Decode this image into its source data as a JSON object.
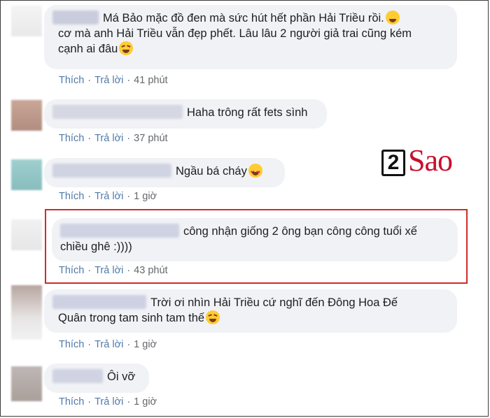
{
  "comments": [
    {
      "text": "Má Bảo mặc đồ đen mà sức hút hết phần Hải Triều rồi.",
      "text2": "cơ mà anh Hải Triều vẫn đẹp phết. Lâu lâu 2 người giả trai cũng kém",
      "text3": "cạnh ai đâu",
      "like": "Thích",
      "reply": "Trả lời",
      "time": "41 phút"
    },
    {
      "text": "Haha trông rất fets sình",
      "like": "Thích",
      "reply": "Trả lời",
      "time": "37 phút"
    },
    {
      "text": "Ngầu bá cháy",
      "like": "Thích",
      "reply": "Trả lời",
      "time": "1 giờ"
    },
    {
      "text": "công nhận giống 2 ông bạn công công tuổi xế",
      "text2": "chiều ghê :))))",
      "like": "Thích",
      "reply": "Trả lời",
      "time": "43 phút"
    },
    {
      "text": "Trời ơi nhìn Hải Triều cứ nghĩ đến Đông Hoa Đế",
      "text2": "Quân trong tam sinh tam thế",
      "like": "Thích",
      "reply": "Trả lời",
      "time": "1 giờ"
    },
    {
      "text": "Ôi vỡ",
      "like": "Thích",
      "reply": "Trả lời",
      "time": "1 giờ"
    }
  ],
  "logo": {
    "number": "2",
    "word": "Sao"
  },
  "colors": {
    "bubble": "#f0f2f5",
    "action_link": "#4f7aa8",
    "highlight": "#d12b2b",
    "logo_red": "#c8102e"
  }
}
